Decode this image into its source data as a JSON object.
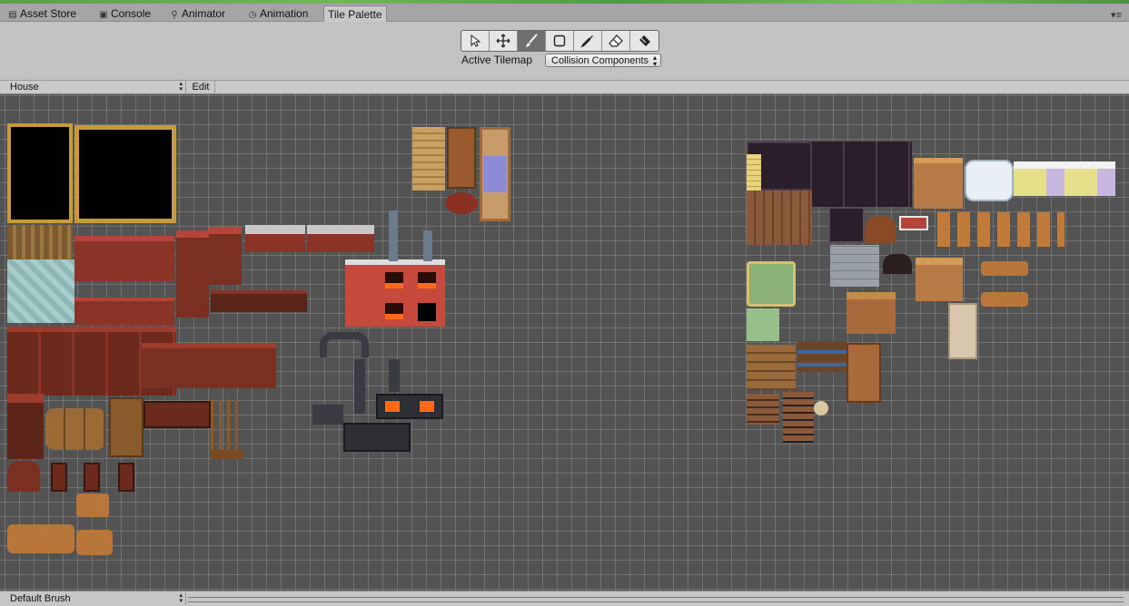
{
  "tabs": [
    {
      "label": "Asset Store",
      "icon": "store-icon",
      "glyph": "▤"
    },
    {
      "label": "Console",
      "icon": "console-icon",
      "glyph": "▣"
    },
    {
      "label": "Animator",
      "icon": "animator-icon",
      "glyph": "⚲"
    },
    {
      "label": "Animation",
      "icon": "animation-clock-icon",
      "glyph": "◷"
    },
    {
      "label": "Tile Palette",
      "icon": "",
      "glyph": ""
    }
  ],
  "window_menu_glyph": "▾≡",
  "tools": [
    {
      "name": "select-tool",
      "icon": "cursor-icon"
    },
    {
      "name": "move-tool",
      "icon": "move-icon"
    },
    {
      "name": "paint-tool",
      "icon": "brush-icon",
      "active": true
    },
    {
      "name": "box-fill-tool",
      "icon": "rectangle-icon"
    },
    {
      "name": "picker-tool",
      "icon": "eyedropper-icon"
    },
    {
      "name": "erase-tool",
      "icon": "eraser-icon"
    },
    {
      "name": "fill-tool",
      "icon": "bucket-icon"
    }
  ],
  "active_tilemap": {
    "label": "Active Tilemap",
    "value": "Collision Components"
  },
  "palette": {
    "selected": "House",
    "edit_label": "Edit"
  },
  "brush": {
    "selected": "Default Brush"
  },
  "colors": {
    "canvas_bg": "#535353",
    "panel_bg": "#c2c2c2",
    "active_tool": "#6f6f6f",
    "wood": "#8a4a26",
    "brick": "#b5453a",
    "gold": "#c79b3a"
  }
}
